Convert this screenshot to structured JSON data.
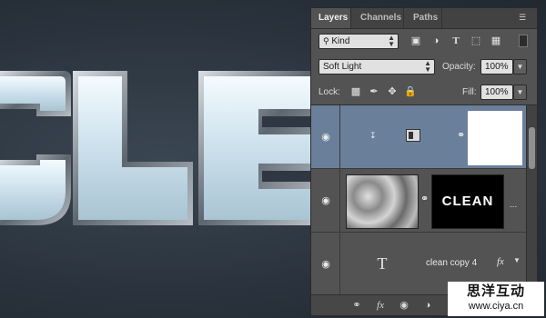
{
  "canvas": {
    "text_fragment": "CLE",
    "left_fragment": "C",
    "colors": {
      "background": "#2b3540",
      "glass": "#cfe6f0",
      "chrome": "#7c8690"
    }
  },
  "panel": {
    "tabs": [
      {
        "label": "Layers",
        "active": true
      },
      {
        "label": "Channels",
        "active": false
      },
      {
        "label": "Paths",
        "active": false
      }
    ],
    "filter": {
      "kind_label": "Kind"
    },
    "blend": {
      "mode": "Soft Light",
      "opacity_label": "Opacity:",
      "opacity_value": "100%"
    },
    "lock": {
      "label": "Lock:",
      "fill_label": "Fill:",
      "fill_value": "100%"
    },
    "layers": [
      {
        "name": "",
        "selected": true,
        "kind": "adjustment",
        "mask": "white"
      },
      {
        "name": "CLEAN",
        "thumb": "clouds",
        "mask_text": "CLEAN",
        "ellipsis": "..."
      },
      {
        "name": "clean copy 4",
        "type_icon": "T",
        "fx": "fx"
      }
    ],
    "footer_icons": [
      "link-icon",
      "fx-icon",
      "mask-icon",
      "adjustment-icon"
    ]
  },
  "watermark": {
    "line1": "思洋互动",
    "line2": "www.ciya.cn"
  }
}
